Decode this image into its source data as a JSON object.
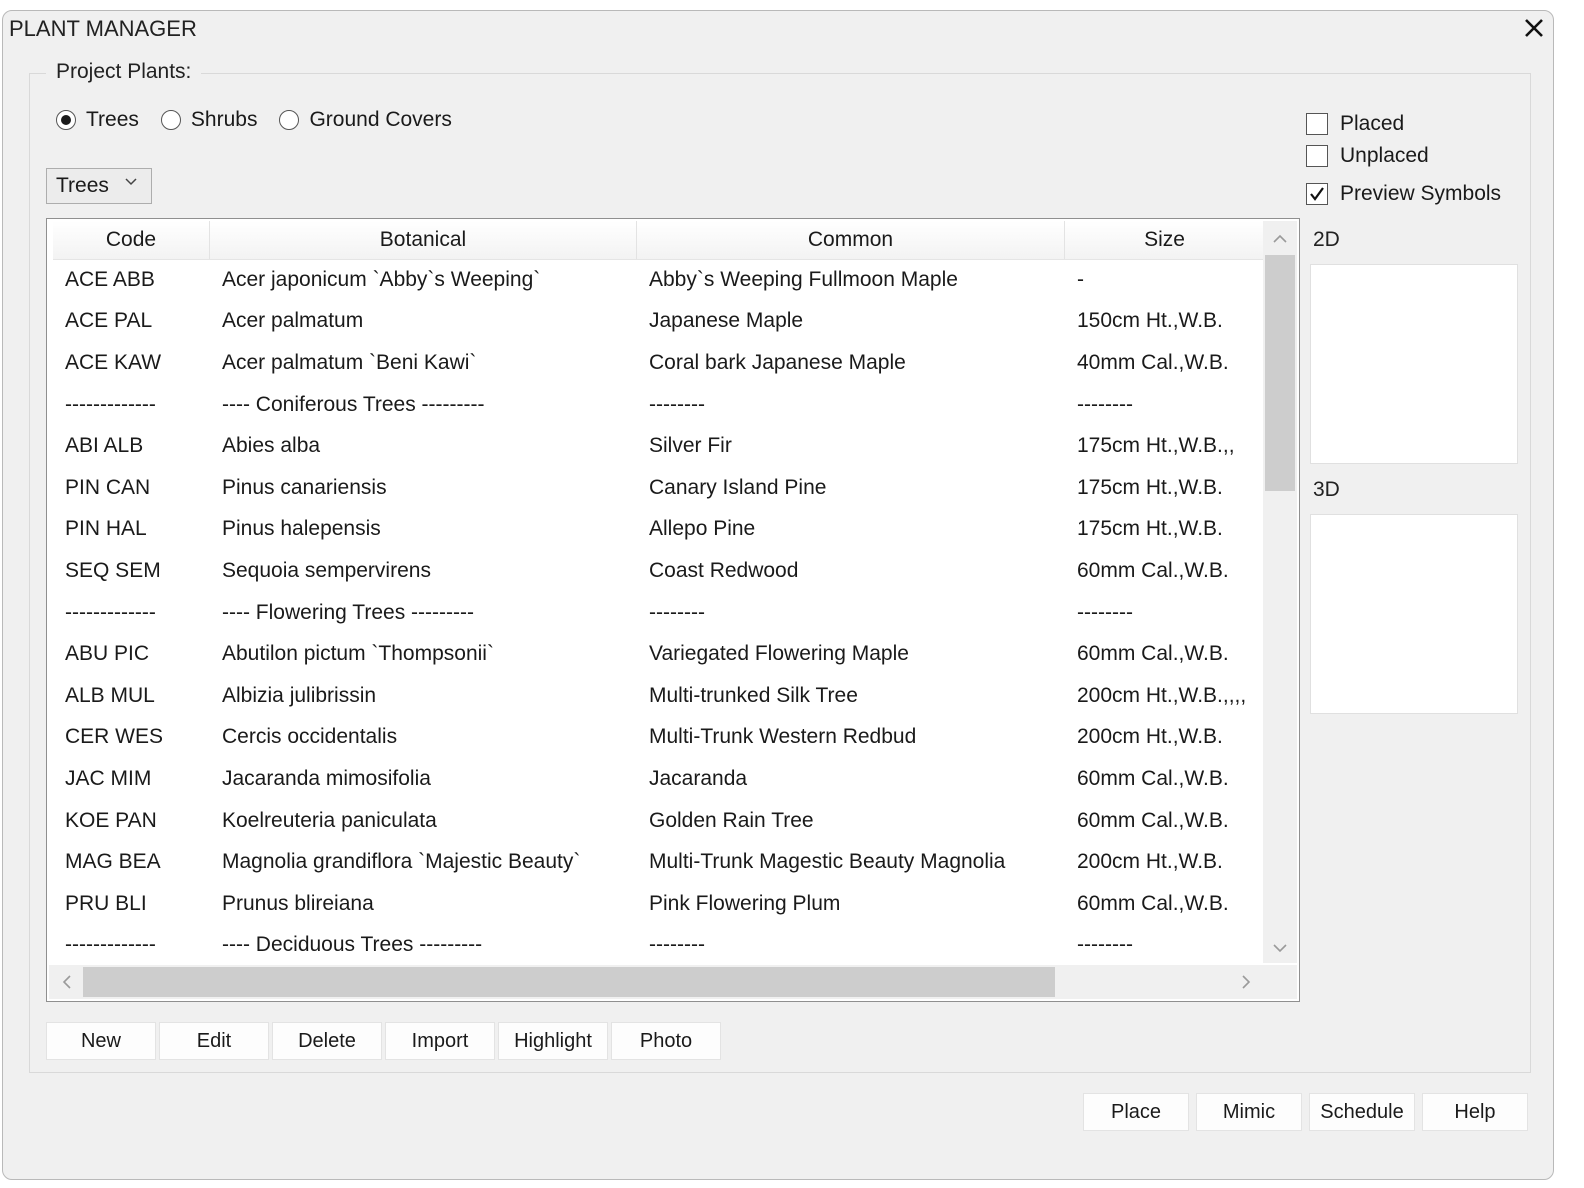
{
  "window": {
    "title": "PLANT MANAGER",
    "close_icon": "close-icon"
  },
  "group": {
    "legend": "Project Plants:"
  },
  "plant_types": {
    "options": [
      {
        "label": "Trees",
        "selected": true
      },
      {
        "label": "Shrubs",
        "selected": false
      },
      {
        "label": "Ground Covers",
        "selected": false
      }
    ]
  },
  "category_dropdown": {
    "selected": "Trees",
    "icon": "chevron-down-icon"
  },
  "filters": {
    "placed": {
      "label": "Placed",
      "checked": false
    },
    "unplaced": {
      "label": "Unplaced",
      "checked": false
    },
    "preview_symbols": {
      "label": "Preview Symbols",
      "checked": true
    }
  },
  "preview": {
    "label_2d": "2D",
    "label_3d": "3D"
  },
  "table": {
    "columns": [
      "Code",
      "Botanical",
      "Common",
      "Size"
    ],
    "rows": [
      [
        "ACE ABB",
        "Acer japonicum `Abby`s Weeping`",
        "Abby`s Weeping Fullmoon Maple",
        "-"
      ],
      [
        "ACE PAL",
        "Acer palmatum",
        "Japanese Maple",
        "150cm Ht.,W.B."
      ],
      [
        "ACE KAW",
        "Acer palmatum `Beni Kawi`",
        "Coral bark Japanese Maple",
        "40mm Cal.,W.B."
      ],
      [
        "-------------",
        "---- Coniferous Trees ---------",
        "--------",
        "--------"
      ],
      [
        "ABI ALB",
        "Abies alba",
        "Silver Fir",
        "175cm Ht.,W.B.,,"
      ],
      [
        "PIN CAN",
        "Pinus canariensis",
        "Canary Island Pine",
        "175cm Ht.,W.B."
      ],
      [
        "PIN HAL",
        "Pinus halepensis",
        "Allepo Pine",
        "175cm Ht.,W.B."
      ],
      [
        "SEQ SEM",
        "Sequoia sempervirens",
        "Coast Redwood",
        "60mm Cal.,W.B."
      ],
      [
        "-------------",
        "---- Flowering Trees ---------",
        "--------",
        "--------"
      ],
      [
        "ABU PIC",
        "Abutilon pictum `Thompsonii`",
        "Variegated Flowering Maple",
        "60mm Cal.,W.B."
      ],
      [
        "ALB MUL",
        "Albizia julibrissin",
        "Multi-trunked Silk Tree",
        "200cm Ht.,W.B.,,,,"
      ],
      [
        "CER WES",
        "Cercis occidentalis",
        "Multi-Trunk Western Redbud",
        "200cm Ht.,W.B."
      ],
      [
        "JAC MIM",
        "Jacaranda mimosifolia",
        "Jacaranda",
        "60mm Cal.,W.B."
      ],
      [
        "KOE PAN",
        "Koelreuteria paniculata",
        "Golden Rain Tree",
        "60mm Cal.,W.B."
      ],
      [
        "MAG BEA",
        "Magnolia grandiflora `Majestic Beauty`",
        "Multi-Trunk Magestic Beauty Magnolia",
        "200cm Ht.,W.B."
      ],
      [
        "PRU BLI",
        "Prunus blireiana",
        "Pink Flowering Plum",
        "60mm Cal.,W.B."
      ],
      [
        "-------------",
        "---- Deciduous Trees ---------",
        "--------",
        "--------"
      ]
    ]
  },
  "action_buttons": [
    "New",
    "Edit",
    "Delete",
    "Import",
    "Highlight",
    "Photo"
  ],
  "footer_buttons": [
    "Place",
    "Mimic",
    "Schedule",
    "Help"
  ]
}
